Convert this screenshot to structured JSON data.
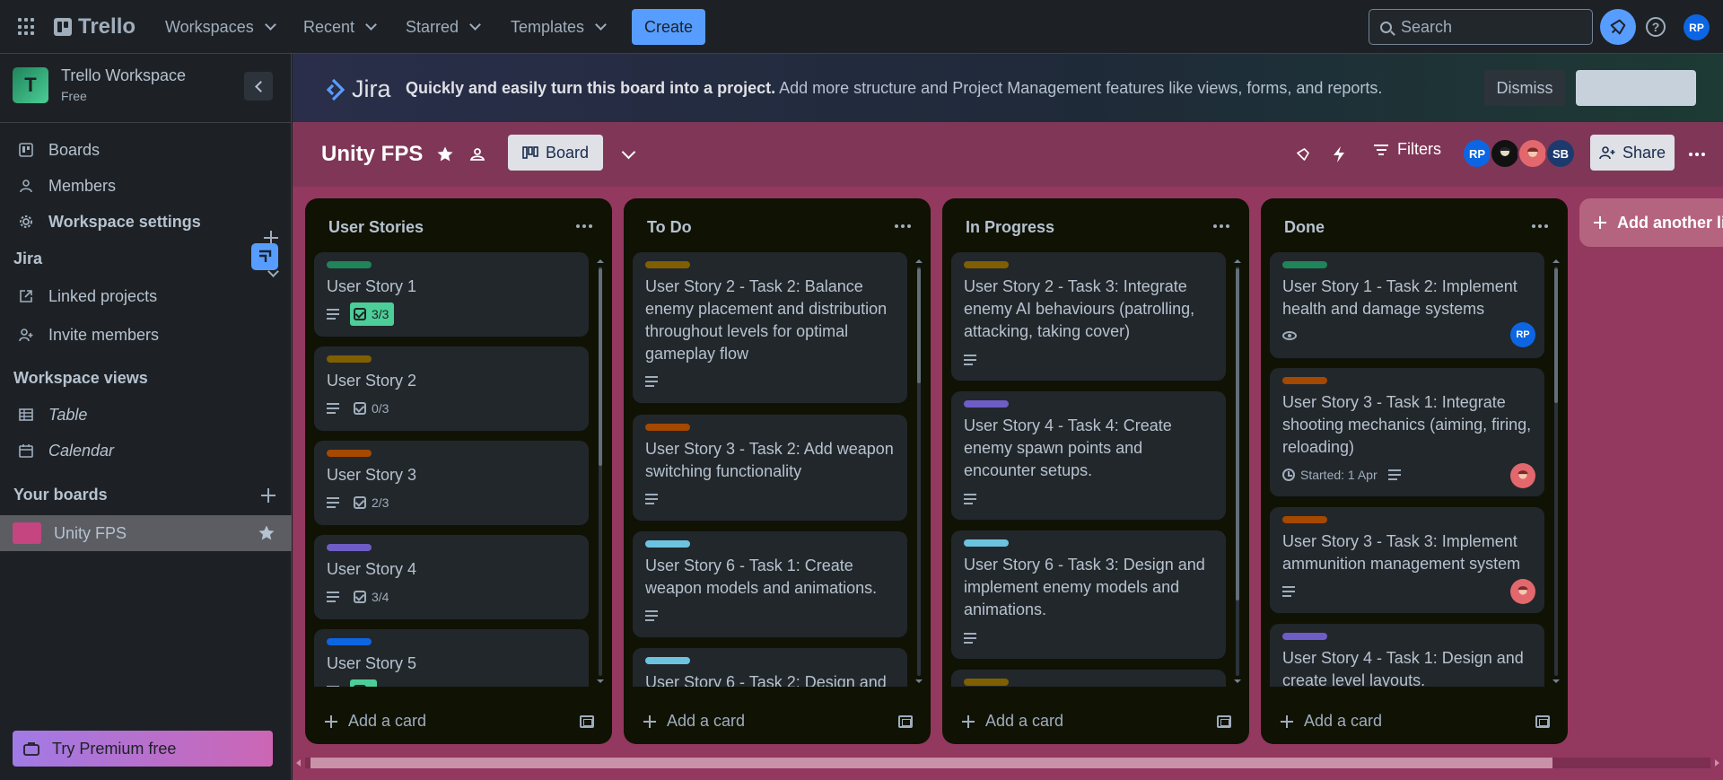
{
  "topnav": {
    "brand": "Trello",
    "workspaces_label": "Workspaces",
    "recent_label": "Recent",
    "starred_label": "Starred",
    "templates_label": "Templates",
    "create_label": "Create",
    "search_placeholder": "Search",
    "avatar_initials": "RP",
    "accent": "#579dff"
  },
  "sidebar": {
    "workspace_logo_letter": "T",
    "workspace_name": "Trello Workspace",
    "workspace_plan": "Free",
    "items": [
      {
        "label": "Boards",
        "icon": "trello-board-icon"
      },
      {
        "label": "Members",
        "icon": "person-icon"
      },
      {
        "label": "Workspace settings",
        "icon": "gear-icon"
      }
    ],
    "jira_heading": "Jira",
    "jira_items": [
      {
        "label": "Linked projects",
        "icon": "external-link-icon"
      },
      {
        "label": "Invite members",
        "icon": "add-person-icon"
      }
    ],
    "views_heading": "Workspace views",
    "views": [
      {
        "label": "Table",
        "icon": "table-icon"
      },
      {
        "label": "Calendar",
        "icon": "calendar-icon"
      }
    ],
    "boards_heading": "Your boards",
    "boards": [
      {
        "label": "Unity FPS",
        "color": "#c4457f",
        "starred": true
      }
    ],
    "premium_label": "Try Premium free"
  },
  "banner": {
    "jira_logo_text": "Jira",
    "bold_text": "Quickly and easily turn this board into a project.",
    "text": " Add more structure and Project Management features like views, forms, and reports.",
    "dismiss_label": "Dismiss"
  },
  "board": {
    "title": "Unity FPS",
    "view_label": "Board",
    "filters_label": "Filters",
    "share_label": "Share",
    "members": [
      {
        "initials": "RP",
        "color": "#0c66e4"
      },
      {
        "initials": "",
        "color": "#111111"
      },
      {
        "initials": "",
        "color": "#e2686e"
      },
      {
        "initials": "SB",
        "color": "#1d3a6e"
      }
    ],
    "background": "#93385f",
    "add_list_label": "Add another list"
  },
  "lists": [
    {
      "title": "User Stories",
      "add_label": "Add a card",
      "cards": [
        {
          "label_color": "#1f845a",
          "title": "User Story 1",
          "badges": {
            "description": true,
            "checklist": "3/3",
            "complete": true
          }
        },
        {
          "label_color": "#7f5f01",
          "title": "User Story 2",
          "badges": {
            "description": true,
            "checklist": "0/3",
            "complete": false
          }
        },
        {
          "label_color": "#a54800",
          "title": "User Story 3",
          "badges": {
            "description": true,
            "checklist": "2/3",
            "complete": false
          }
        },
        {
          "label_color": "#6e5dc6",
          "title": "User Story 4",
          "badges": {
            "description": true,
            "checklist": "3/4",
            "complete": false
          }
        },
        {
          "label_color": "#0c66e4",
          "title": "User Story 5",
          "badges": {
            "description": true,
            "checklist": "",
            "complete": true
          }
        }
      ]
    },
    {
      "title": "To Do",
      "add_label": "Add a card",
      "cards": [
        {
          "label_color": "#7f5f01",
          "title": "User Story 2 - Task 2: Balance enemy placement and distribution throughout levels for optimal gameplay flow",
          "badges": {
            "description": true
          }
        },
        {
          "label_color": "#a54800",
          "title": "User Story 3 - Task 2: Add weapon switching functionality",
          "badges": {
            "description": true
          }
        },
        {
          "label_color": "#6cc3e0",
          "title": "User Story 6 - Task 1: Create weapon models and animations.",
          "badges": {
            "description": true
          }
        },
        {
          "label_color": "#6cc3e0",
          "title": "User Story 6 - Task 2: Design and",
          "badges": {
            "description": false
          }
        }
      ]
    },
    {
      "title": "In Progress",
      "add_label": "Add a card",
      "cards": [
        {
          "label_color": "#7f5f01",
          "title": "User Story 2 - Task 3: Integrate enemy AI behaviours (patrolling, attacking, taking cover)",
          "badges": {
            "description": true
          }
        },
        {
          "label_color": "#6e5dc6",
          "title": "User Story 4 - Task 4: Create enemy spawn points and encounter setups.",
          "badges": {
            "description": true
          }
        },
        {
          "label_color": "#6cc3e0",
          "title": "User Story 6 - Task 3: Design and implement enemy models and animations.",
          "badges": {
            "description": true
          }
        },
        {
          "label_color": "#7f5f01",
          "title": "",
          "badges": {
            "description": false
          }
        }
      ]
    },
    {
      "title": "Done",
      "add_label": "Add a card",
      "cards": [
        {
          "label_color": "#1f845a",
          "title": "User Story 1 - Task 2: Implement health and damage systems",
          "badges": {
            "watch": true,
            "member": "RP"
          }
        },
        {
          "label_color": "#a54800",
          "title": "User Story 3 - Task 1: Integrate shooting mechanics (aiming, firing, reloading)",
          "badges": {
            "started": "Started: 1 Apr",
            "description": true
          }
        },
        {
          "label_color": "#a54800",
          "title": "User Story 3 - Task 3: Implement ammunition management system",
          "badges": {
            "description": true
          }
        },
        {
          "label_color": "#6e5dc6",
          "title": "User Story 4 - Task 1: Design and create level layouts.",
          "badges": {
            "description": false
          }
        }
      ]
    }
  ]
}
